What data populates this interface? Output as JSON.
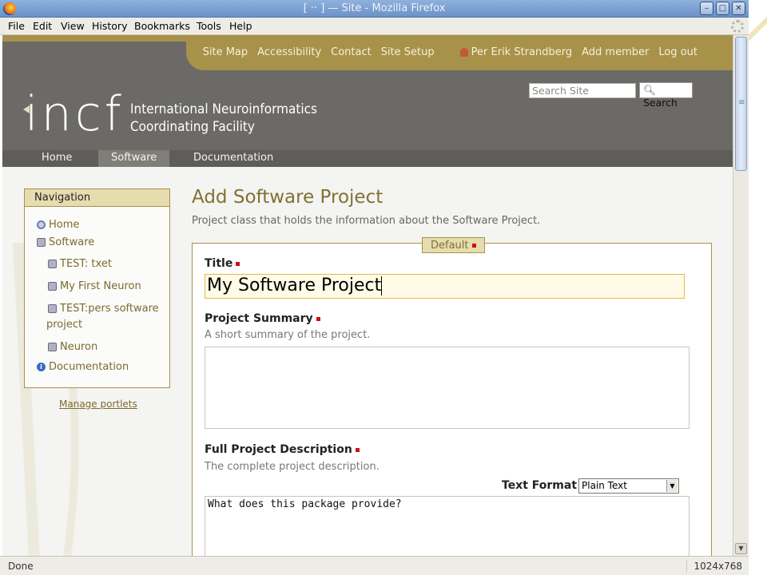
{
  "browser": {
    "window_title": "[ ·· ] — Site - Mozilla Firefox",
    "menu": [
      {
        "label": "File"
      },
      {
        "label": "Edit"
      },
      {
        "label": "View"
      },
      {
        "label": "History"
      },
      {
        "label": "Bookmarks"
      },
      {
        "label": "Tools"
      },
      {
        "label": "Help"
      }
    ],
    "status_text": "Done",
    "status_size": "1024x768"
  },
  "site": {
    "actions": [
      "Site Map",
      "Accessibility",
      "Contact",
      "Site Setup"
    ],
    "user": "Per Erik Strandberg",
    "add_member": "Add member",
    "logout": "Log out",
    "search_placeholder": "Search Site",
    "search_button": "Search",
    "logo_text": "incf",
    "logo_name_line1": "International Neuroinformatics",
    "logo_name_line2": "Coordinating Facility",
    "tabs": [
      {
        "label": "Home",
        "active": false
      },
      {
        "label": "Software",
        "active": true
      },
      {
        "label": "Documentation",
        "active": false
      }
    ]
  },
  "navigation": {
    "header": "Navigation",
    "items": [
      {
        "label": "Home",
        "icon": "home-icon"
      },
      {
        "label": "Software",
        "icon": "software-icon"
      },
      {
        "label": "TEST: txet",
        "icon": "software-icon"
      },
      {
        "label": "My First Neuron",
        "icon": "software-icon"
      },
      {
        "label": "TEST:pers software",
        "label2": "project",
        "icon": "software-icon"
      },
      {
        "label": "Neuron",
        "icon": "software-icon"
      },
      {
        "label": "Documentation",
        "icon": "info-icon"
      }
    ],
    "manage_portlets": "Manage portlets"
  },
  "form": {
    "title": "Add Software Project",
    "description": "Project class that holds the information about the Software Project.",
    "fieldset_legend": "Default",
    "title_label": "Title",
    "title_value": "My Software Project",
    "summary_label": "Project Summary",
    "summary_help": "A short summary of the project.",
    "summary_value": "",
    "full_desc_label": "Full Project Description",
    "full_desc_help": "The complete project description.",
    "text_format_label": "Text Format",
    "text_format_value": "Plain Text",
    "full_desc_value": "What does this package provide?"
  },
  "colors": {
    "accent_gold": "#a8924a",
    "header_gray": "#6b6a66",
    "required_red": "#d01010"
  }
}
